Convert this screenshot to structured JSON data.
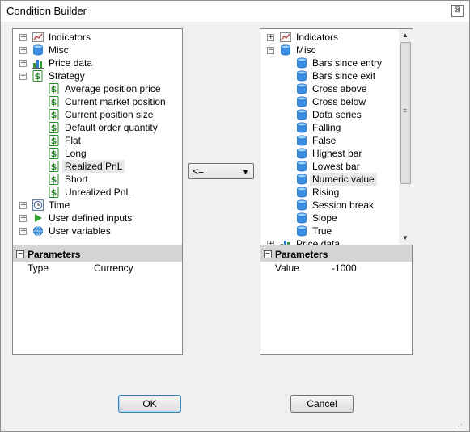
{
  "window": {
    "title": "Condition Builder",
    "close": "⊠"
  },
  "left": {
    "tree": [
      {
        "label": "Indicators",
        "expander": "+",
        "icon": "chart-line-icon"
      },
      {
        "label": "Misc",
        "expander": "+",
        "icon": "database-icon"
      },
      {
        "label": "Price data",
        "expander": "+",
        "icon": "bar-chart-icon"
      },
      {
        "label": "Strategy",
        "expander": "−",
        "icon": "dollar-icon"
      },
      {
        "label": "Average position price",
        "icon": "dollar-icon"
      },
      {
        "label": "Current market position",
        "icon": "dollar-icon"
      },
      {
        "label": "Current position size",
        "icon": "dollar-icon"
      },
      {
        "label": "Default order quantity",
        "icon": "dollar-icon"
      },
      {
        "label": "Flat",
        "icon": "dollar-icon"
      },
      {
        "label": "Long",
        "icon": "dollar-icon"
      },
      {
        "label": "Realized PnL",
        "icon": "dollar-icon",
        "selected": true
      },
      {
        "label": "Short",
        "icon": "dollar-icon"
      },
      {
        "label": "Unrealized PnL",
        "icon": "dollar-icon"
      },
      {
        "label": "Time",
        "expander": "+",
        "icon": "clock-icon"
      },
      {
        "label": "User defined inputs",
        "expander": "+",
        "icon": "play-icon"
      },
      {
        "label": "User variables",
        "expander": "+",
        "icon": "globe-icon"
      }
    ],
    "params": {
      "header": "Parameters",
      "key": "Type",
      "value": "Currency"
    }
  },
  "operator": {
    "value": "<="
  },
  "right": {
    "tree": [
      {
        "label": "Indicators",
        "expander": "+",
        "icon": "chart-line-icon"
      },
      {
        "label": "Misc",
        "expander": "−",
        "icon": "database-icon"
      },
      {
        "label": "Bars since entry",
        "icon": "database-icon"
      },
      {
        "label": "Bars since exit",
        "icon": "database-icon"
      },
      {
        "label": "Cross above",
        "icon": "database-icon"
      },
      {
        "label": "Cross below",
        "icon": "database-icon"
      },
      {
        "label": "Data series",
        "icon": "database-icon"
      },
      {
        "label": "Falling",
        "icon": "database-icon"
      },
      {
        "label": "False",
        "icon": "database-icon"
      },
      {
        "label": "Highest bar",
        "icon": "database-icon"
      },
      {
        "label": "Lowest bar",
        "icon": "database-icon"
      },
      {
        "label": "Numeric value",
        "icon": "database-icon",
        "selected": true
      },
      {
        "label": "Rising",
        "icon": "database-icon"
      },
      {
        "label": "Session break",
        "icon": "database-icon"
      },
      {
        "label": "Slope",
        "icon": "database-icon"
      },
      {
        "label": "True",
        "icon": "database-icon"
      },
      {
        "label": "Price data",
        "expander": "+",
        "icon": "bar-chart-icon"
      }
    ],
    "params": {
      "header": "Parameters",
      "key": "Value",
      "value": "-1000"
    }
  },
  "buttons": {
    "ok": "OK",
    "cancel": "Cancel"
  },
  "colors": {
    "header": "#d4d4d4",
    "border": "#828790",
    "dollar": "#2e8b2e",
    "db": "#2f7fd0"
  }
}
